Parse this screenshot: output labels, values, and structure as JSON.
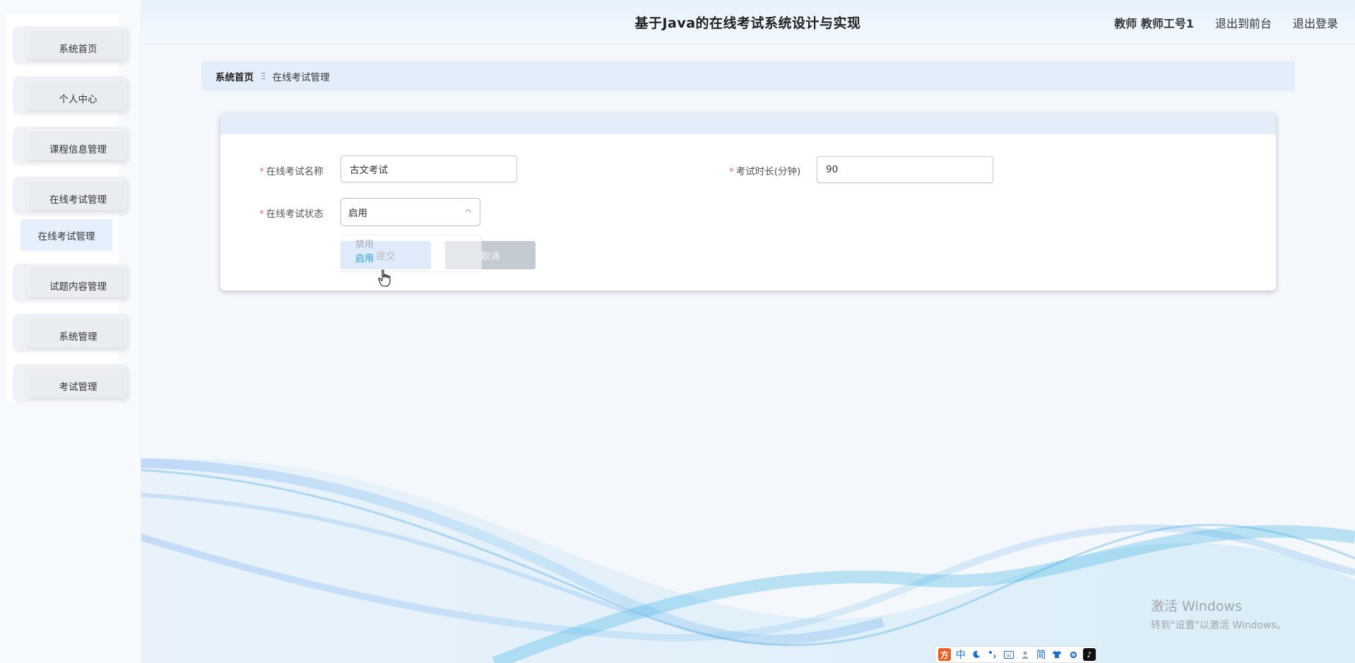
{
  "header": {
    "title": "基于Java的在线考试系统设计与实现",
    "user": "教师 教师工号1",
    "back_to_front": "退出到前台",
    "logout": "退出登录"
  },
  "sidebar": {
    "items": [
      {
        "label": "系统首页"
      },
      {
        "label": "个人中心"
      },
      {
        "label": "课程信息管理"
      },
      {
        "label": "在线考试管理"
      },
      {
        "label": "试题内容管理"
      },
      {
        "label": "系统管理"
      },
      {
        "label": "考试管理"
      }
    ],
    "submenu_active": "在线考试管理"
  },
  "breadcrumb": {
    "home": "系统首页",
    "separator": "Ξ",
    "current": "在线考试管理"
  },
  "form": {
    "exam_name_label": "在线考试名称",
    "exam_name_value": "古文考试",
    "duration_label": "考试时长(分钟)",
    "duration_value": "90",
    "status_label": "在线考试状态",
    "status_value": "启用",
    "status_options": [
      "禁用",
      "启用"
    ],
    "required_mark": "*",
    "submit_label": "提交",
    "cancel_label": "取消"
  },
  "watermark": {
    "line1": "激活 Windows",
    "line2": "转到\"设置\"以激活 Windows。"
  },
  "ime_toolbar": {
    "logo": "方",
    "mode": "中",
    "script": "简",
    "tiktok": "♪"
  },
  "colors": {
    "accent": "#e4eefb",
    "required": "#f56c6c",
    "submit_bg": "#b9d3f4",
    "cancel_bg": "#c4cad2"
  }
}
